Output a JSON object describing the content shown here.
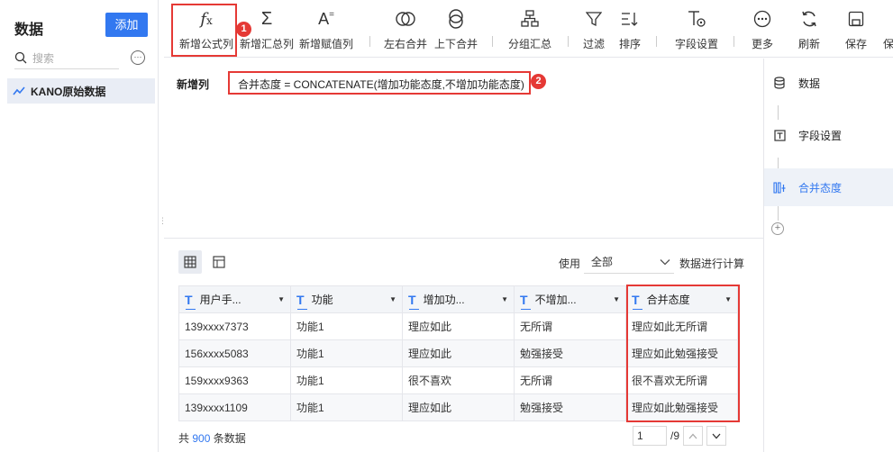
{
  "sidebar": {
    "title": "数据",
    "add_label": "添加",
    "search_placeholder": "搜索",
    "more_label": "···",
    "dataset_label": "KANO原始数据"
  },
  "toolbar": {
    "items": [
      {
        "label": "新增公式列",
        "icon": "fx-icon"
      },
      {
        "label": "新增汇总列",
        "icon": "sigma-icon"
      },
      {
        "label": "新增赋值列",
        "icon": "assign-icon"
      },
      {
        "label": "左右合并",
        "icon": "merge-horizontal-icon"
      },
      {
        "label": "上下合并",
        "icon": "merge-vertical-icon"
      },
      {
        "label": "分组汇总",
        "icon": "group-icon"
      },
      {
        "label": "过滤",
        "icon": "filter-icon"
      },
      {
        "label": "排序",
        "icon": "sort-icon"
      },
      {
        "label": "字段设置",
        "icon": "field-settings-icon"
      },
      {
        "label": "更多",
        "icon": "more-icon"
      },
      {
        "label": "刷新",
        "icon": "refresh-icon"
      },
      {
        "label": "保存",
        "icon": "save-icon"
      },
      {
        "label": "保",
        "icon": "truncated-icon"
      }
    ]
  },
  "annotations": {
    "badge1": "1",
    "badge2": "2"
  },
  "formula": {
    "label": "新增列",
    "text": "合并态度 = CONCATENATE(增加功能态度,不增加功能态度)"
  },
  "right_panel": {
    "items": [
      {
        "label": "数据",
        "icon": "database-icon"
      },
      {
        "label": "字段设置",
        "icon": "field-icon"
      },
      {
        "label": "合并态度",
        "icon": "merge-column-icon"
      }
    ],
    "add_label": "+"
  },
  "data_area": {
    "use_label": "使用",
    "use_value": "全部",
    "use_after": "数据进行计算",
    "columns": [
      "用户手...",
      "功能",
      "增加功...",
      "不增加...",
      "合并态度"
    ],
    "rows": [
      [
        "139xxxx7373",
        "功能1",
        "理应如此",
        "无所谓",
        "理应如此无所谓"
      ],
      [
        "156xxxx5083",
        "功能1",
        "理应如此",
        "勉强接受",
        "理应如此勉强接受"
      ],
      [
        "159xxxx9363",
        "功能1",
        "很不喜欢",
        "无所谓",
        "很不喜欢无所谓"
      ],
      [
        "139xxxx1109",
        "功能1",
        "理应如此",
        "勉强接受",
        "理应如此勉强接受"
      ]
    ],
    "footer_prefix": "共",
    "footer_count": "900",
    "footer_suffix": "条数据",
    "page_current": "1",
    "page_total": "/9"
  },
  "colors": {
    "accent": "#3278f0",
    "highlight": "#e53935"
  }
}
